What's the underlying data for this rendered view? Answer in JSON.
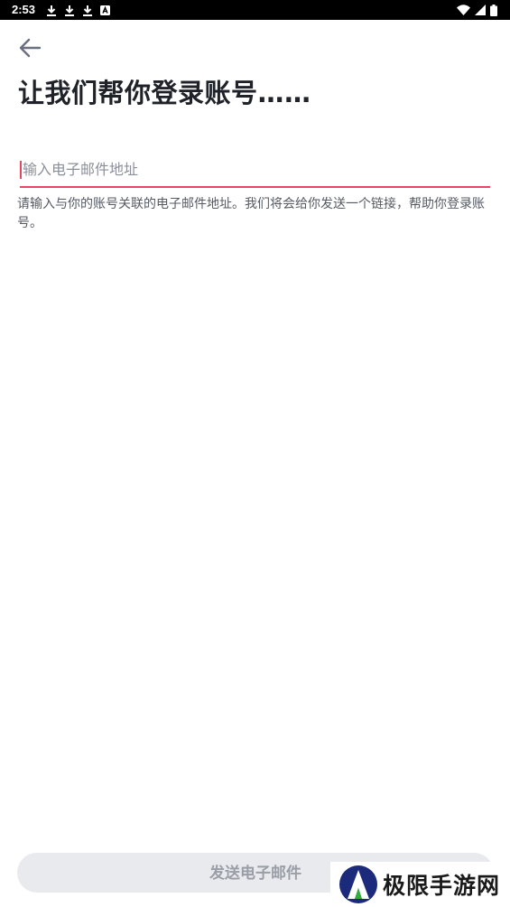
{
  "status_bar": {
    "time": "2:53",
    "left_icons": [
      "download-icon",
      "download-icon",
      "download-icon",
      "app-notification-icon"
    ],
    "right_icons": [
      "wifi-icon",
      "signal-icon",
      "battery-icon"
    ]
  },
  "header": {
    "back_icon": "arrow-left-icon",
    "title": "让我们帮你登录账号……"
  },
  "form": {
    "email_placeholder": "输入电子邮件地址",
    "email_value": "",
    "helper_text": "请输入与你的账号关联的电子邮件地址。我们将会给你发送一个链接，帮助你登录账号。"
  },
  "footer": {
    "send_button_label": "发送电子邮件"
  },
  "watermark": {
    "text": "极限手游网"
  },
  "colors": {
    "accent": "#e8475f",
    "title": "#1f2329",
    "button_bg": "#e9eaee",
    "button_text": "#9a9ea6"
  }
}
